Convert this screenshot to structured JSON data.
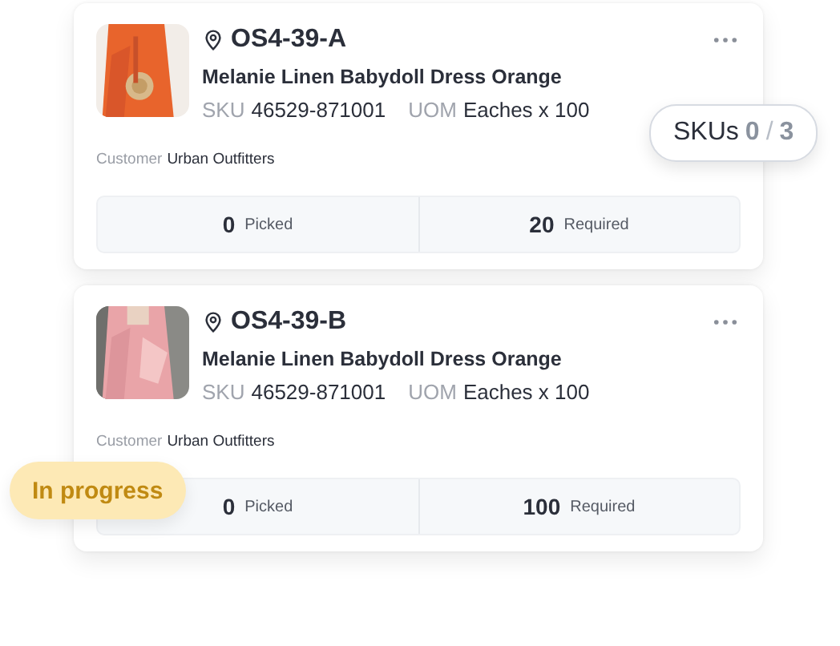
{
  "cards": [
    {
      "location": "OS4-39-A",
      "product": "Melanie Linen Babydoll Dress Orange",
      "sku_label": "SKU",
      "sku": "46529-871001",
      "uom_label": "UOM",
      "uom": "Eaches x 100",
      "customer_label": "Customer",
      "customer": "Urban Outfitters",
      "picked": "0",
      "picked_label": "Picked",
      "required": "20",
      "required_label": "Required"
    },
    {
      "location": "OS4-39-B",
      "product": "Melanie Linen Babydoll Dress Orange",
      "sku_label": "SKU",
      "sku": "46529-871001",
      "uom_label": "UOM",
      "uom": "Eaches x 100",
      "customer_label": "Customer",
      "customer": "Urban Outfitters",
      "picked": "0",
      "picked_label": "Picked",
      "required": "100",
      "required_label": "Required"
    }
  ],
  "skus_badge": {
    "label": "SKUs",
    "done": "0",
    "separator": "/",
    "total": "3"
  },
  "status_badge": "In progress"
}
